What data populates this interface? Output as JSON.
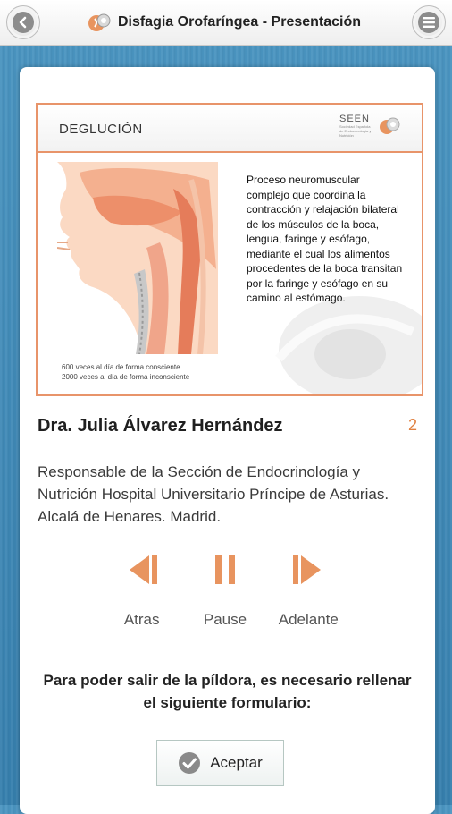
{
  "header": {
    "title": "Disfagia Orofaríngea - Presentación",
    "back_icon": "chevron-left-icon",
    "menu_icon": "hamburger-menu-icon"
  },
  "slide": {
    "title": "DEGLUCIÓN",
    "logo_text": "SEEN",
    "logo_subtext": "Sociedad Española de Endocrinología y Nutrición",
    "description": "Proceso neuromuscular complejo que coordina la contracción y  relajación bilateral de los músculos de la boca, lengua, faringe y esófago, mediante el cual los alimentos procedentes de la boca transitan por la faringe y esófago en su camino al estómago.",
    "caption_line1": "600 veces al día de forma consciente",
    "caption_line2": "2000 veces al día de forma  inconsciente"
  },
  "presenter": {
    "name": "Dra. Julia Álvarez Hernández",
    "page_number": "2",
    "bio": "Responsable de la Sección de Endocrinología y Nutrición Hospital Universitario Príncipe de Asturias. Alcalá de Henares. Madrid."
  },
  "controls": {
    "back_label": "Atras",
    "pause_label": "Pause",
    "forward_label": "Adelante"
  },
  "footer": {
    "notice": "Para poder salir de la píldora, es necesario rellenar el siguiente formulario:",
    "accept_label": "Aceptar"
  },
  "colors": {
    "accent": "#e8945f",
    "background": "#3b86b4"
  }
}
